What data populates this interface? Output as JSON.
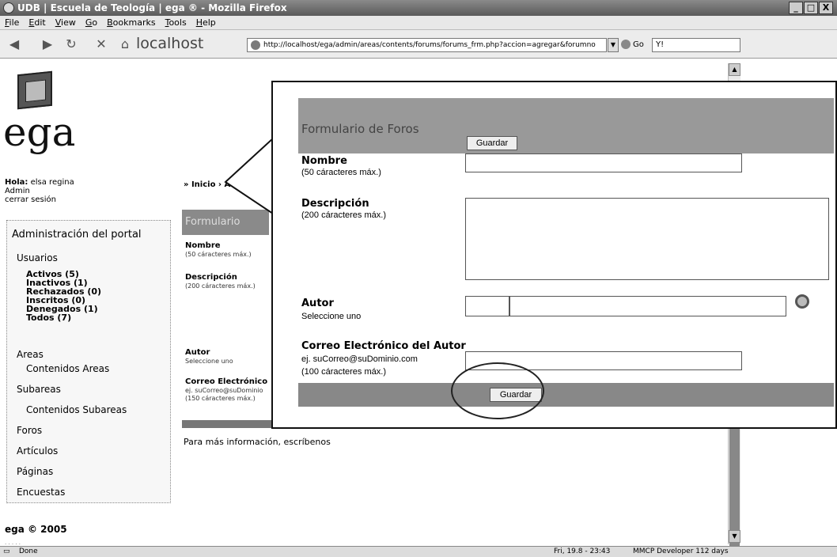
{
  "window": {
    "title": "UDB | Escuela de Teología | ega ® - Mozilla Firefox",
    "controls": [
      "_",
      "□",
      "X"
    ]
  },
  "menu": [
    "File",
    "Edit",
    "View",
    "Go",
    "Bookmarks",
    "Tools",
    "Help"
  ],
  "nav": {
    "location_label": "localhost",
    "url": "http://localhost/ega/admin/areas/contents/forums/forums_frm.php?accion=agregar&forumno",
    "go_label": "Go",
    "search_value": "Y!"
  },
  "sidebar": {
    "logo_text": "ega",
    "greeting_bold": "Hola:",
    "greeting_name": "elsa regina",
    "role": "Admin",
    "logout": "cerrar sesión",
    "heading": "Administración del portal",
    "usuarios": "Usuarios",
    "user_counts": [
      "Activos (5)",
      "Inactivos (1)",
      "Rechazados (0)",
      "Inscritos (0)",
      "Denegados (1)",
      "Todos (7)"
    ],
    "areas": "Areas",
    "contenidos_areas": "Contenidos Areas",
    "subareas": "Subareas",
    "contenidos_subareas": "Contenidos Subareas",
    "foros": "Foros",
    "articulos": "Artículos",
    "paginas": "Páginas",
    "encuestas": "Encuestas",
    "copyright": "ega © 2005"
  },
  "breadcrumb": "» Inicio › Ad",
  "background_form": {
    "title": "Formulario",
    "nombre": "Nombre",
    "nombre_hint": "(50 cáracteres máx.)",
    "descripcion": "Descripción",
    "descripcion_hint": "(200 cáracteres máx.)",
    "autor": "Autor",
    "autor_hint": "Seleccione uno",
    "correo": "Correo Electrónico",
    "correo_hint1": "ej. suCorreo@suDominio",
    "correo_hint2": "(150 cáracteres máx.)"
  },
  "info_text": "Para más información, escríbenos",
  "zoom_form": {
    "title": "Formulario de Foros",
    "save_top": "Guardar",
    "nombre": "Nombre",
    "nombre_hint": "(50 cáracteres máx.)",
    "descripcion": "Descripción",
    "descripcion_hint": "(200 cáracteres máx.)",
    "autor": "Autor",
    "autor_hint": "Seleccione uno",
    "correo": "Correo Electrónico del Autor",
    "correo_hint1": "ej. suCorreo@suDominio.com",
    "correo_hint2": "(100 cáracteres máx.)",
    "save_bottom": "Guardar"
  },
  "status": {
    "done": "Done",
    "datetime": "Fri, 19.8 - 23:43",
    "extra": "MMCP Developer 112 days"
  }
}
